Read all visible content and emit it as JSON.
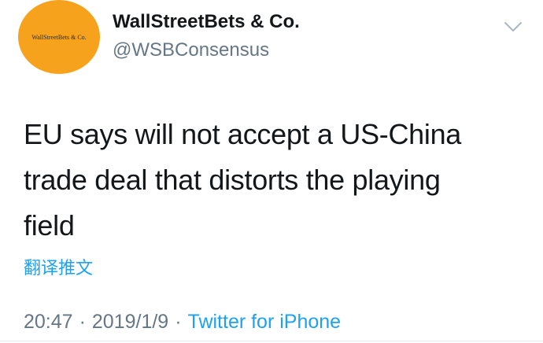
{
  "account": {
    "display_name": "WallStreetBets & Co.",
    "handle": "@WSBConsensus",
    "avatar_text": "WallStreetBets & Co.",
    "avatar_color": "#f7a21c"
  },
  "tweet": {
    "lines": [
      "EU says will not accept a US-China",
      "trade deal that distorts the playing",
      "field"
    ],
    "translate_label": "翻译推文"
  },
  "meta": {
    "time": "20:47",
    "separator": "·",
    "date": "2019/1/9",
    "source": "Twitter for iPhone"
  },
  "icons": {
    "menu": "chevron-down-icon"
  },
  "colors": {
    "link": "#1da1f2",
    "secondary_text": "#657786",
    "primary_text": "#14171a"
  }
}
